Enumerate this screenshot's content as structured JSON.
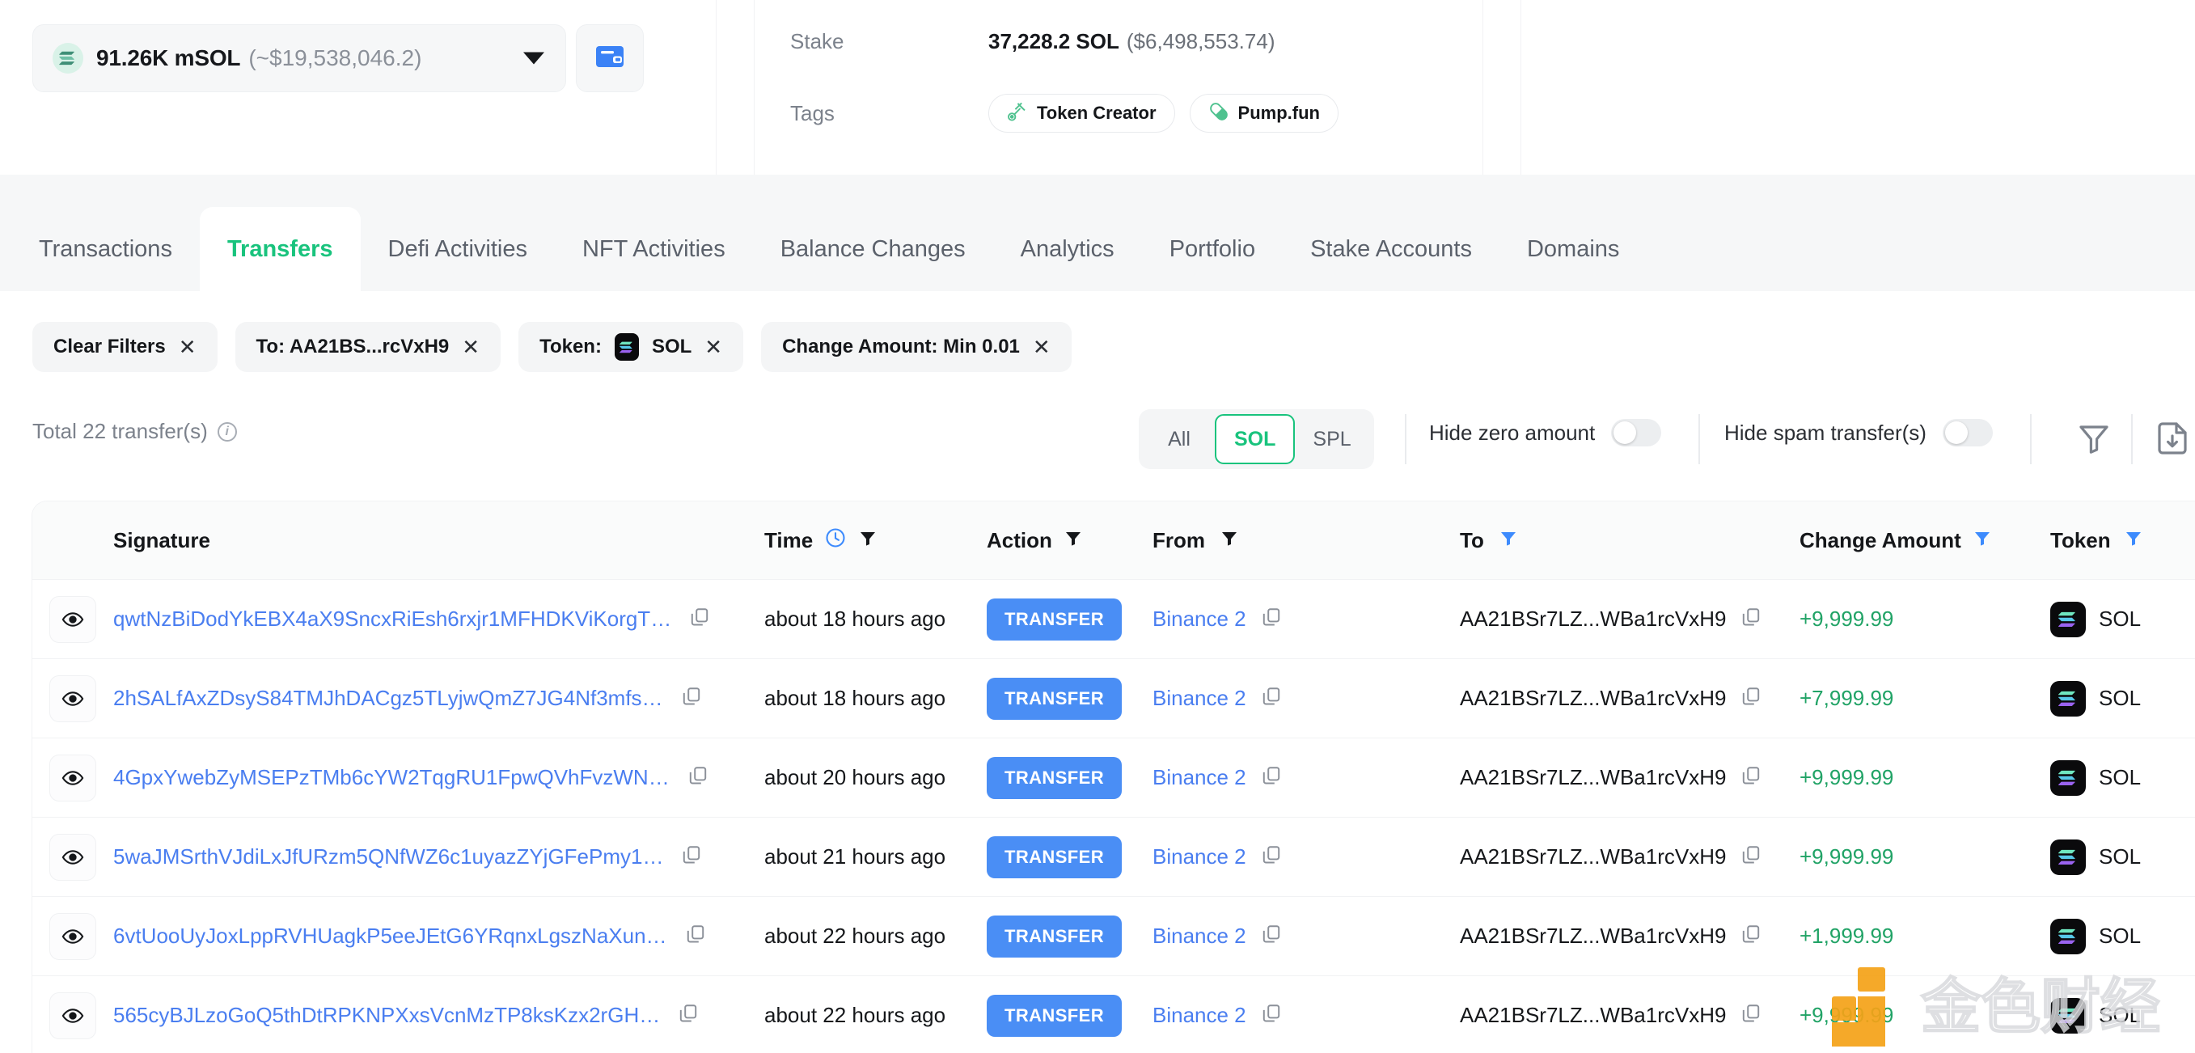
{
  "header": {
    "token_selector": {
      "amount": "91.26K mSOL",
      "usd": "(~$19,538,046.2)",
      "icon": "solana-icon",
      "caret": "chevron-down-icon"
    },
    "wallet_button_icon": "wallet-icon",
    "stake": {
      "label": "Stake",
      "value": "37,228.2 SOL",
      "usd": "($6,498,553.74)"
    },
    "tags": {
      "label": "Tags",
      "items": [
        {
          "text": "Token Creator",
          "icon": "token-creator-icon"
        },
        {
          "text": "Pump.fun",
          "icon": "pill-icon"
        }
      ]
    }
  },
  "tabs": [
    {
      "label": "Transactions",
      "active": false
    },
    {
      "label": "Transfers",
      "active": true
    },
    {
      "label": "Defi Activities",
      "active": false
    },
    {
      "label": "NFT Activities",
      "active": false
    },
    {
      "label": "Balance Changes",
      "active": false
    },
    {
      "label": "Analytics",
      "active": false
    },
    {
      "label": "Portfolio",
      "active": false
    },
    {
      "label": "Stake Accounts",
      "active": false
    },
    {
      "label": "Domains",
      "active": false
    }
  ],
  "filter_chips": [
    {
      "label": "Clear Filters",
      "has_token_icon": false
    },
    {
      "label": "To: AA21BS...rcVxH9",
      "has_token_icon": false
    },
    {
      "label": "Token:",
      "suffix": "SOL",
      "has_token_icon": true
    },
    {
      "label": "Change Amount: Min 0.01",
      "has_token_icon": false
    }
  ],
  "toolbar": {
    "total_text": "Total 22 transfer(s)",
    "info_icon": "info-icon",
    "segments": [
      {
        "label": "All",
        "active": false
      },
      {
        "label": "SOL",
        "active": true
      },
      {
        "label": "SPL",
        "active": false
      }
    ],
    "hide_zero_label": "Hide zero amount",
    "hide_zero_on": false,
    "hide_spam_label": "Hide spam transfer(s)",
    "hide_spam_on": false,
    "filter_icon": "funnel-icon",
    "download_icon": "download-file-icon"
  },
  "table": {
    "columns": [
      {
        "key": "signature",
        "label": "Signature",
        "filter": "none"
      },
      {
        "key": "time",
        "label": "Time",
        "filter": "dark",
        "extra_icon": "clock-icon"
      },
      {
        "key": "action",
        "label": "Action",
        "filter": "dark"
      },
      {
        "key": "from",
        "label": "From",
        "filter": "dark"
      },
      {
        "key": "to",
        "label": "To",
        "filter": "blue"
      },
      {
        "key": "change_amount",
        "label": "Change Amount",
        "filter": "blue"
      },
      {
        "key": "token",
        "label": "Token",
        "filter": "blue"
      }
    ],
    "rows": [
      {
        "signature": "qwtNzBiDodYkEBX4aX9SncxRiEsh6rxjr1MFHDKViKorgT…",
        "time": "about 18 hours ago",
        "action": "TRANSFER",
        "from": "Binance 2",
        "to": "AA21BSr7LZ...WBa1rcVxH9",
        "change_amount": "+9,999.99",
        "token": "SOL"
      },
      {
        "signature": "2hSALfAxZDsyS84TMJhDACgz5TLyjwQmZ7JG4Nf3mfs…",
        "time": "about 18 hours ago",
        "action": "TRANSFER",
        "from": "Binance 2",
        "to": "AA21BSr7LZ...WBa1rcVxH9",
        "change_amount": "+7,999.99",
        "token": "SOL"
      },
      {
        "signature": "4GpxYwebZyMSEPzTMb6cYW2TqgRU1FpwQVhFvzWN…",
        "time": "about 20 hours ago",
        "action": "TRANSFER",
        "from": "Binance 2",
        "to": "AA21BSr7LZ...WBa1rcVxH9",
        "change_amount": "+9,999.99",
        "token": "SOL"
      },
      {
        "signature": "5waJMSrthVJdiLxJfURzm5QNfWZ6c1uyazZYjGFePmy1…",
        "time": "about 21 hours ago",
        "action": "TRANSFER",
        "from": "Binance 2",
        "to": "AA21BSr7LZ...WBa1rcVxH9",
        "change_amount": "+9,999.99",
        "token": "SOL"
      },
      {
        "signature": "6vtUooUyJoxLppRVHUagkP5eeJEtG6YRqnxLgszNaXun…",
        "time": "about 22 hours ago",
        "action": "TRANSFER",
        "from": "Binance 2",
        "to": "AA21BSr7LZ...WBa1rcVxH9",
        "change_amount": "+1,999.99",
        "token": "SOL"
      },
      {
        "signature": "565cyBJLzoGoQ5thDtRPKNPXxsVcnMzTP8ksKzx2rGH…",
        "time": "about 22 hours ago",
        "action": "TRANSFER",
        "from": "Binance 2",
        "to": "AA21BSr7LZ...WBa1rcVxH9",
        "change_amount": "+9,999.99",
        "token": "SOL"
      }
    ]
  },
  "watermark": {
    "text": "金色财经",
    "logo_color": "#f5a217"
  },
  "colors": {
    "accent_green": "#19c37d",
    "link_blue": "#4a7ef0",
    "badge_blue": "#4a8ef5",
    "amount_green": "#21a366",
    "filter_blue": "#3d8bfd",
    "muted": "#7c828c"
  }
}
